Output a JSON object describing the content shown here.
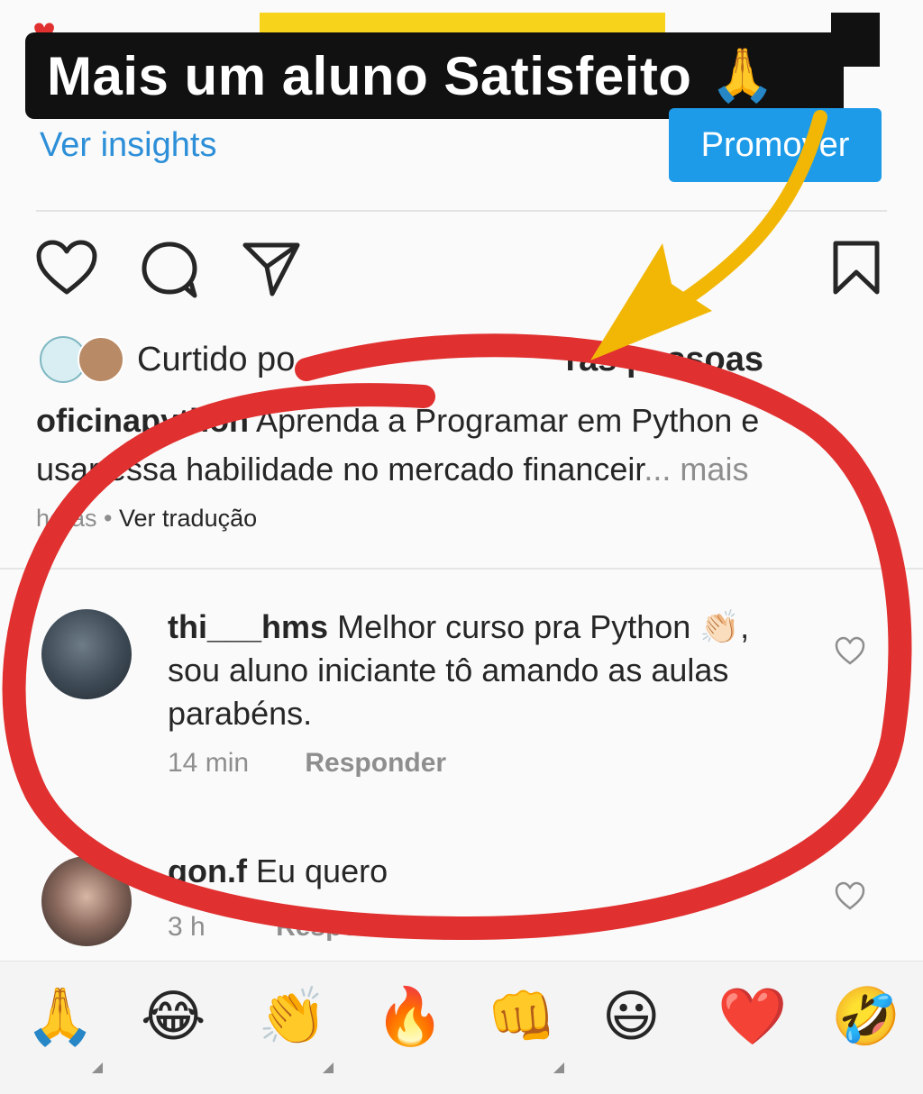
{
  "banner": {
    "text": "Mais um aluno Satisfeito",
    "emoji": "🙏"
  },
  "post": {
    "insights_link": "Ver insights",
    "promote_button": "Promover",
    "liked_prefix": "Curtido po",
    "liked_suffix": "ras pessoas",
    "caption_user": "oficinapython",
    "caption_text_line1": "Aprenda a Programar em Python e",
    "caption_text_line2": "usar essa habilidade no mercado financeir",
    "caption_more": "... mais",
    "time_ago": "horas",
    "translate_link": "Ver tradução"
  },
  "comments": [
    {
      "user": "thi___hms",
      "text_line1": "Melhor curso pra Python 👏🏻,",
      "text_line2": "sou aluno iniciante tô amando as aulas",
      "text_line3": "parabéns.",
      "time": "14 min",
      "reply_label": "Responder"
    },
    {
      "user": "gon.f",
      "text": "Eu quero",
      "time": "3 h",
      "reply_label": "Responder"
    }
  ],
  "emoji_bar": [
    "🙏",
    "😂",
    "👏",
    "🔥",
    "👊",
    "😃",
    "❤️",
    "🤣"
  ],
  "colors": {
    "instagram_blue": "#1e9be8",
    "annotation_red": "#e0302f",
    "annotation_yellow": "#f2b705",
    "banner_bg": "#111111"
  }
}
